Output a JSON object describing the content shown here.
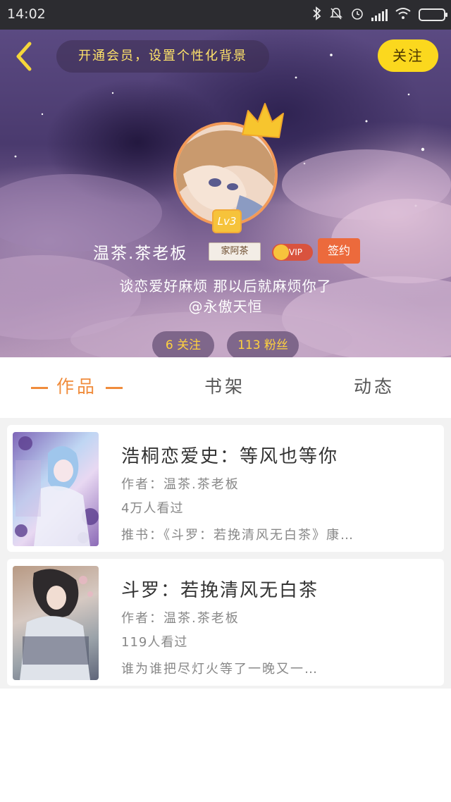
{
  "status_bar": {
    "time": "14:02",
    "icons": [
      "bluetooth-icon",
      "mute-icon",
      "alarm-icon",
      "signal-icon",
      "wifi-icon",
      "battery-icon"
    ]
  },
  "header": {
    "back_icon": "back-chevron-icon",
    "vip_background_prompt": "开通会员，设置个性化背景",
    "follow_label": "关注",
    "level": "Lv3",
    "username": "温茶.茶老板",
    "fan_tag": "家阿茶",
    "vip_label": "VIP",
    "sign_label": "签约",
    "bio_line1": "谈恋爱好麻烦 那以后就麻烦你了",
    "bio_line2": "@永傲天恒",
    "stats": {
      "following": "6 关注",
      "fans": "113 粉丝"
    }
  },
  "tabs": {
    "works": "作品",
    "shelf": "书架",
    "feed": "动态",
    "active": "works"
  },
  "books": [
    {
      "title": "浩桐恋爱史：等风也等你",
      "author": "作者：温茶.茶老板",
      "views": "4万人看过",
      "desc": "推书：《斗罗：若挽清风无白茶》康…"
    },
    {
      "title": "斗罗：若挽清风无白茶",
      "author": "作者：温茶.茶老板",
      "views": "119人看过",
      "desc": "谁为谁把尽灯火等了一晚又一…"
    }
  ],
  "colors": {
    "accent_orange": "#f08c3c",
    "follow_yellow": "#fbd81e",
    "stat_text": "#ffd23e",
    "sign_badge": "#ec6a3c"
  }
}
